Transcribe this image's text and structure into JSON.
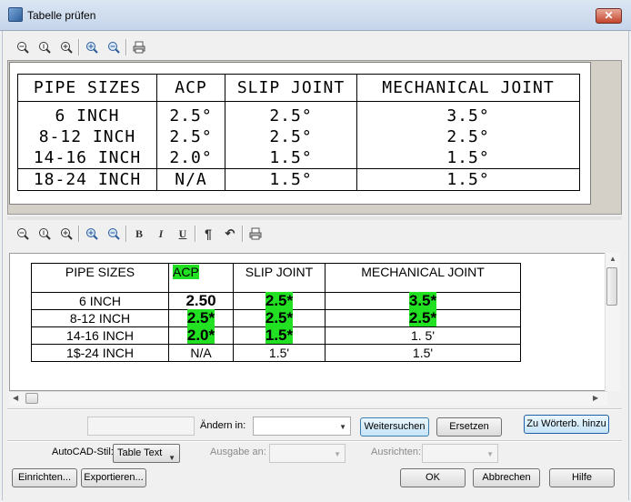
{
  "window": {
    "title": "Tabelle prüfen",
    "close_label": "✕"
  },
  "preview_toolbar": [
    "zoom-out",
    "zoom-reset",
    "zoom-in",
    "zoom-extents",
    "zoom-previous",
    "print"
  ],
  "editor_toolbar": {
    "bold": "B",
    "italic": "I",
    "underline": "U",
    "paragraph": "¶",
    "undo": "↶"
  },
  "preview_table": {
    "headers": [
      "PIPE SIZES",
      "ACP",
      "SLIP JOINT",
      "MECHANICAL JOINT"
    ],
    "sizes": [
      "6 INCH",
      "8-12 INCH",
      "14-16 INCH"
    ],
    "acp": [
      "2.5°",
      "2.5°",
      "2.0°"
    ],
    "slip": [
      "2.5°",
      "2.5°",
      "1.5°"
    ],
    "mech": [
      "3.5°",
      "2.5°",
      "1.5°"
    ],
    "last_row": [
      "18-24 INCH",
      "N/A",
      "1.5°",
      "1.5°"
    ]
  },
  "editor_table": {
    "headers": [
      "PIPE SIZES",
      "ACP",
      "SLIP JOINT",
      "MECHANICAL JOINT"
    ],
    "rows": [
      [
        "6 INCH",
        "2.50",
        "2.5*",
        "3.5*"
      ],
      [
        "8-12 INCH",
        "2.5*",
        "2.5*",
        "2.5*"
      ],
      [
        "14-16 INCH",
        "2.0*",
        "1.5*",
        "1. 5'"
      ],
      [
        "1$-24 INCH",
        "N/A",
        "1.5'",
        "1.5'"
      ]
    ]
  },
  "find_row": {
    "change_label": "Ändern in:",
    "search_button": "Weitersuchen",
    "replace_button": "Ersetzen",
    "dictionary_button": "Zu Wörterb. hinzu"
  },
  "options_row": {
    "style_label": "AutoCAD-Stil:",
    "style_value": "Table Text",
    "output_label": "Ausgabe an:",
    "align_label": "Ausrichten:"
  },
  "buttons": {
    "setup": "Einrichten...",
    "export": "Exportieren...",
    "ok": "OK",
    "cancel": "Abbrechen",
    "help": "Hilfe"
  },
  "colors": {
    "highlight": "#22e022",
    "title_bar": "#c5d5ea"
  }
}
